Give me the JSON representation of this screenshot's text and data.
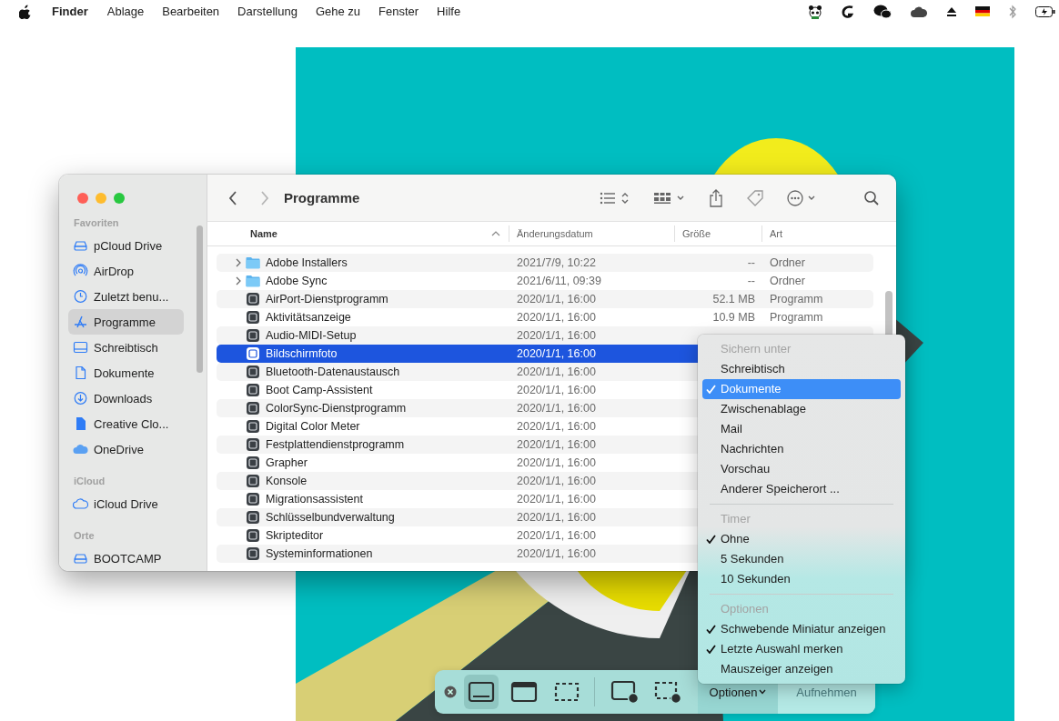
{
  "menubar": {
    "app_name": "Finder",
    "items": [
      "Ablage",
      "Bearbeiten",
      "Darstellung",
      "Gehe zu",
      "Fenster",
      "Hilfe"
    ]
  },
  "finder": {
    "title": "Programme",
    "nav_buttons": [
      {
        "kind": "back",
        "disabled": false
      },
      {
        "kind": "forward",
        "disabled": true
      }
    ],
    "sidebar": [
      {
        "header": "Favoriten",
        "items": [
          {
            "label": "pCloud Drive",
            "kind": "drive",
            "selected": false
          },
          {
            "label": "AirDrop",
            "kind": "airdrop",
            "selected": false
          },
          {
            "label": "Zuletzt benu...",
            "kind": "recents",
            "selected": false
          },
          {
            "label": "Programme",
            "kind": "applications",
            "selected": true
          },
          {
            "label": "Schreibtisch",
            "kind": "desktop",
            "selected": false
          },
          {
            "label": "Dokumente",
            "kind": "documents",
            "selected": false
          },
          {
            "label": "Downloads",
            "kind": "downloads",
            "selected": false
          },
          {
            "label": "Creative Clo...",
            "kind": "file",
            "selected": false
          },
          {
            "label": "OneDrive",
            "kind": "cloud",
            "selected": false
          }
        ]
      },
      {
        "header": "iCloud",
        "items": [
          {
            "label": "iCloud Drive",
            "kind": "cloud-outline",
            "selected": false
          }
        ]
      },
      {
        "header": "Orte",
        "items": [
          {
            "label": "BOOTCAMP",
            "kind": "drive",
            "selected": false
          }
        ]
      }
    ],
    "columns": [
      {
        "label": "Name",
        "sorted": true
      },
      {
        "label": "Änderungsdatum",
        "sorted": false
      },
      {
        "label": "Größe",
        "sorted": false
      },
      {
        "label": "Art",
        "sorted": false
      }
    ],
    "rows": [
      {
        "name": "Adobe Installers",
        "kind": "folder",
        "expandable": true,
        "date": "2021/7/9, 10:22",
        "size": "--",
        "type": "Ordner",
        "selected": false
      },
      {
        "name": "Adobe Sync",
        "kind": "folder",
        "expandable": true,
        "date": "2021/6/11, 09:39",
        "size": "--",
        "type": "Ordner",
        "selected": false
      },
      {
        "name": "AirPort-Dienstprogramm",
        "kind": "app",
        "expandable": false,
        "date": "2020/1/1, 16:00",
        "size": "52.1 MB",
        "type": "Programm",
        "selected": false
      },
      {
        "name": "Aktivitätsanzeige",
        "kind": "app",
        "expandable": false,
        "date": "2020/1/1, 16:00",
        "size": "10.9 MB",
        "type": "Programm",
        "selected": false
      },
      {
        "name": "Audio-MIDI-Setup",
        "kind": "app",
        "expandable": false,
        "date": "2020/1/1, 16:00",
        "selected": false
      },
      {
        "name": "Bildschirmfoto",
        "kind": "app",
        "expandable": false,
        "date": "2020/1/1, 16:00",
        "selected": true
      },
      {
        "name": "Bluetooth-Datenaustausch",
        "kind": "app",
        "expandable": false,
        "date": "2020/1/1, 16:00",
        "selected": false
      },
      {
        "name": "Boot Camp-Assistent",
        "kind": "app",
        "expandable": false,
        "date": "2020/1/1, 16:00",
        "selected": false
      },
      {
        "name": "ColorSync-Dienstprogramm",
        "kind": "app",
        "expandable": false,
        "date": "2020/1/1, 16:00",
        "selected": false
      },
      {
        "name": "Digital Color Meter",
        "kind": "app",
        "expandable": false,
        "date": "2020/1/1, 16:00",
        "selected": false
      },
      {
        "name": "Festplattendienstprogramm",
        "kind": "app",
        "expandable": false,
        "date": "2020/1/1, 16:00",
        "selected": false
      },
      {
        "name": "Grapher",
        "kind": "app",
        "expandable": false,
        "date": "2020/1/1, 16:00",
        "selected": false
      },
      {
        "name": "Konsole",
        "kind": "app",
        "expandable": false,
        "date": "2020/1/1, 16:00",
        "selected": false
      },
      {
        "name": "Migrationsassistent",
        "kind": "app",
        "expandable": false,
        "date": "2020/1/1, 16:00",
        "selected": false
      },
      {
        "name": "Schlüsselbundverwaltung",
        "kind": "app",
        "expandable": false,
        "date": "2020/1/1, 16:00",
        "selected": false
      },
      {
        "name": "Skripteditor",
        "kind": "app",
        "expandable": false,
        "date": "2020/1/1, 16:00",
        "selected": false
      },
      {
        "name": "Systeminformationen",
        "kind": "app",
        "expandable": false,
        "date": "2020/1/1, 16:00",
        "selected": false
      }
    ]
  },
  "options_menu": [
    {
      "header": "Sichern unter",
      "items": [
        {
          "label": "Schreibtisch",
          "checked": false,
          "highlighted": false
        },
        {
          "label": "Dokumente",
          "checked": true,
          "highlighted": true
        },
        {
          "label": "Zwischenablage",
          "checked": false,
          "highlighted": false
        },
        {
          "label": "Mail",
          "checked": false,
          "highlighted": false
        },
        {
          "label": "Nachrichten",
          "checked": false,
          "highlighted": false
        },
        {
          "label": "Vorschau",
          "checked": false,
          "highlighted": false
        },
        {
          "label": "Anderer Speicherort ...",
          "checked": false,
          "highlighted": false
        }
      ]
    },
    {
      "header": "Timer",
      "items": [
        {
          "label": "Ohne",
          "checked": true,
          "highlighted": false
        },
        {
          "label": "5 Sekunden",
          "checked": false,
          "highlighted": false
        },
        {
          "label": "10 Sekunden",
          "checked": false,
          "highlighted": false
        }
      ]
    },
    {
      "header": "Optionen",
      "items": [
        {
          "label": "Schwebende Miniatur anzeigen",
          "checked": true,
          "highlighted": false
        },
        {
          "label": "Letzte Auswahl merken",
          "checked": true,
          "highlighted": false
        },
        {
          "label": "Mauszeiger anzeigen",
          "checked": false,
          "highlighted": false
        }
      ]
    }
  ],
  "capture_toolbar": {
    "modes": [
      {
        "kind": "screen",
        "selected": true
      },
      {
        "kind": "window",
        "selected": false
      },
      {
        "kind": "selection",
        "selected": false
      },
      {
        "kind": "record-screen",
        "selected": false
      },
      {
        "kind": "record-selection",
        "selected": false
      }
    ],
    "options_label": "Optionen",
    "capture_label": "Aufnehmen"
  }
}
